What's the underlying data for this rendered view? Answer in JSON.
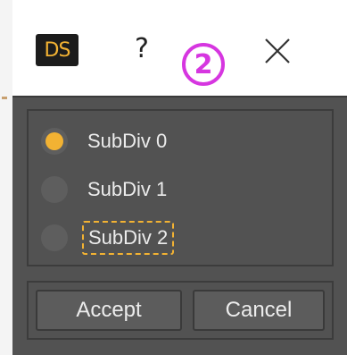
{
  "titlebar": {
    "logo_text": "DS",
    "help_label": "?",
    "annotation_marker": "2",
    "close_glyph": "×"
  },
  "subdivision": {
    "options": [
      {
        "label": "SubDiv 0",
        "checked": true
      },
      {
        "label": "SubDiv 1",
        "checked": false
      },
      {
        "label": "SubDiv 2",
        "checked": false,
        "focused": true
      }
    ]
  },
  "buttons": {
    "accept_label": "Accept",
    "cancel_label": "Cancel"
  },
  "colors": {
    "accent": "#f2b233",
    "dialog_bg": "#525252",
    "annotation": "#d636e0"
  }
}
